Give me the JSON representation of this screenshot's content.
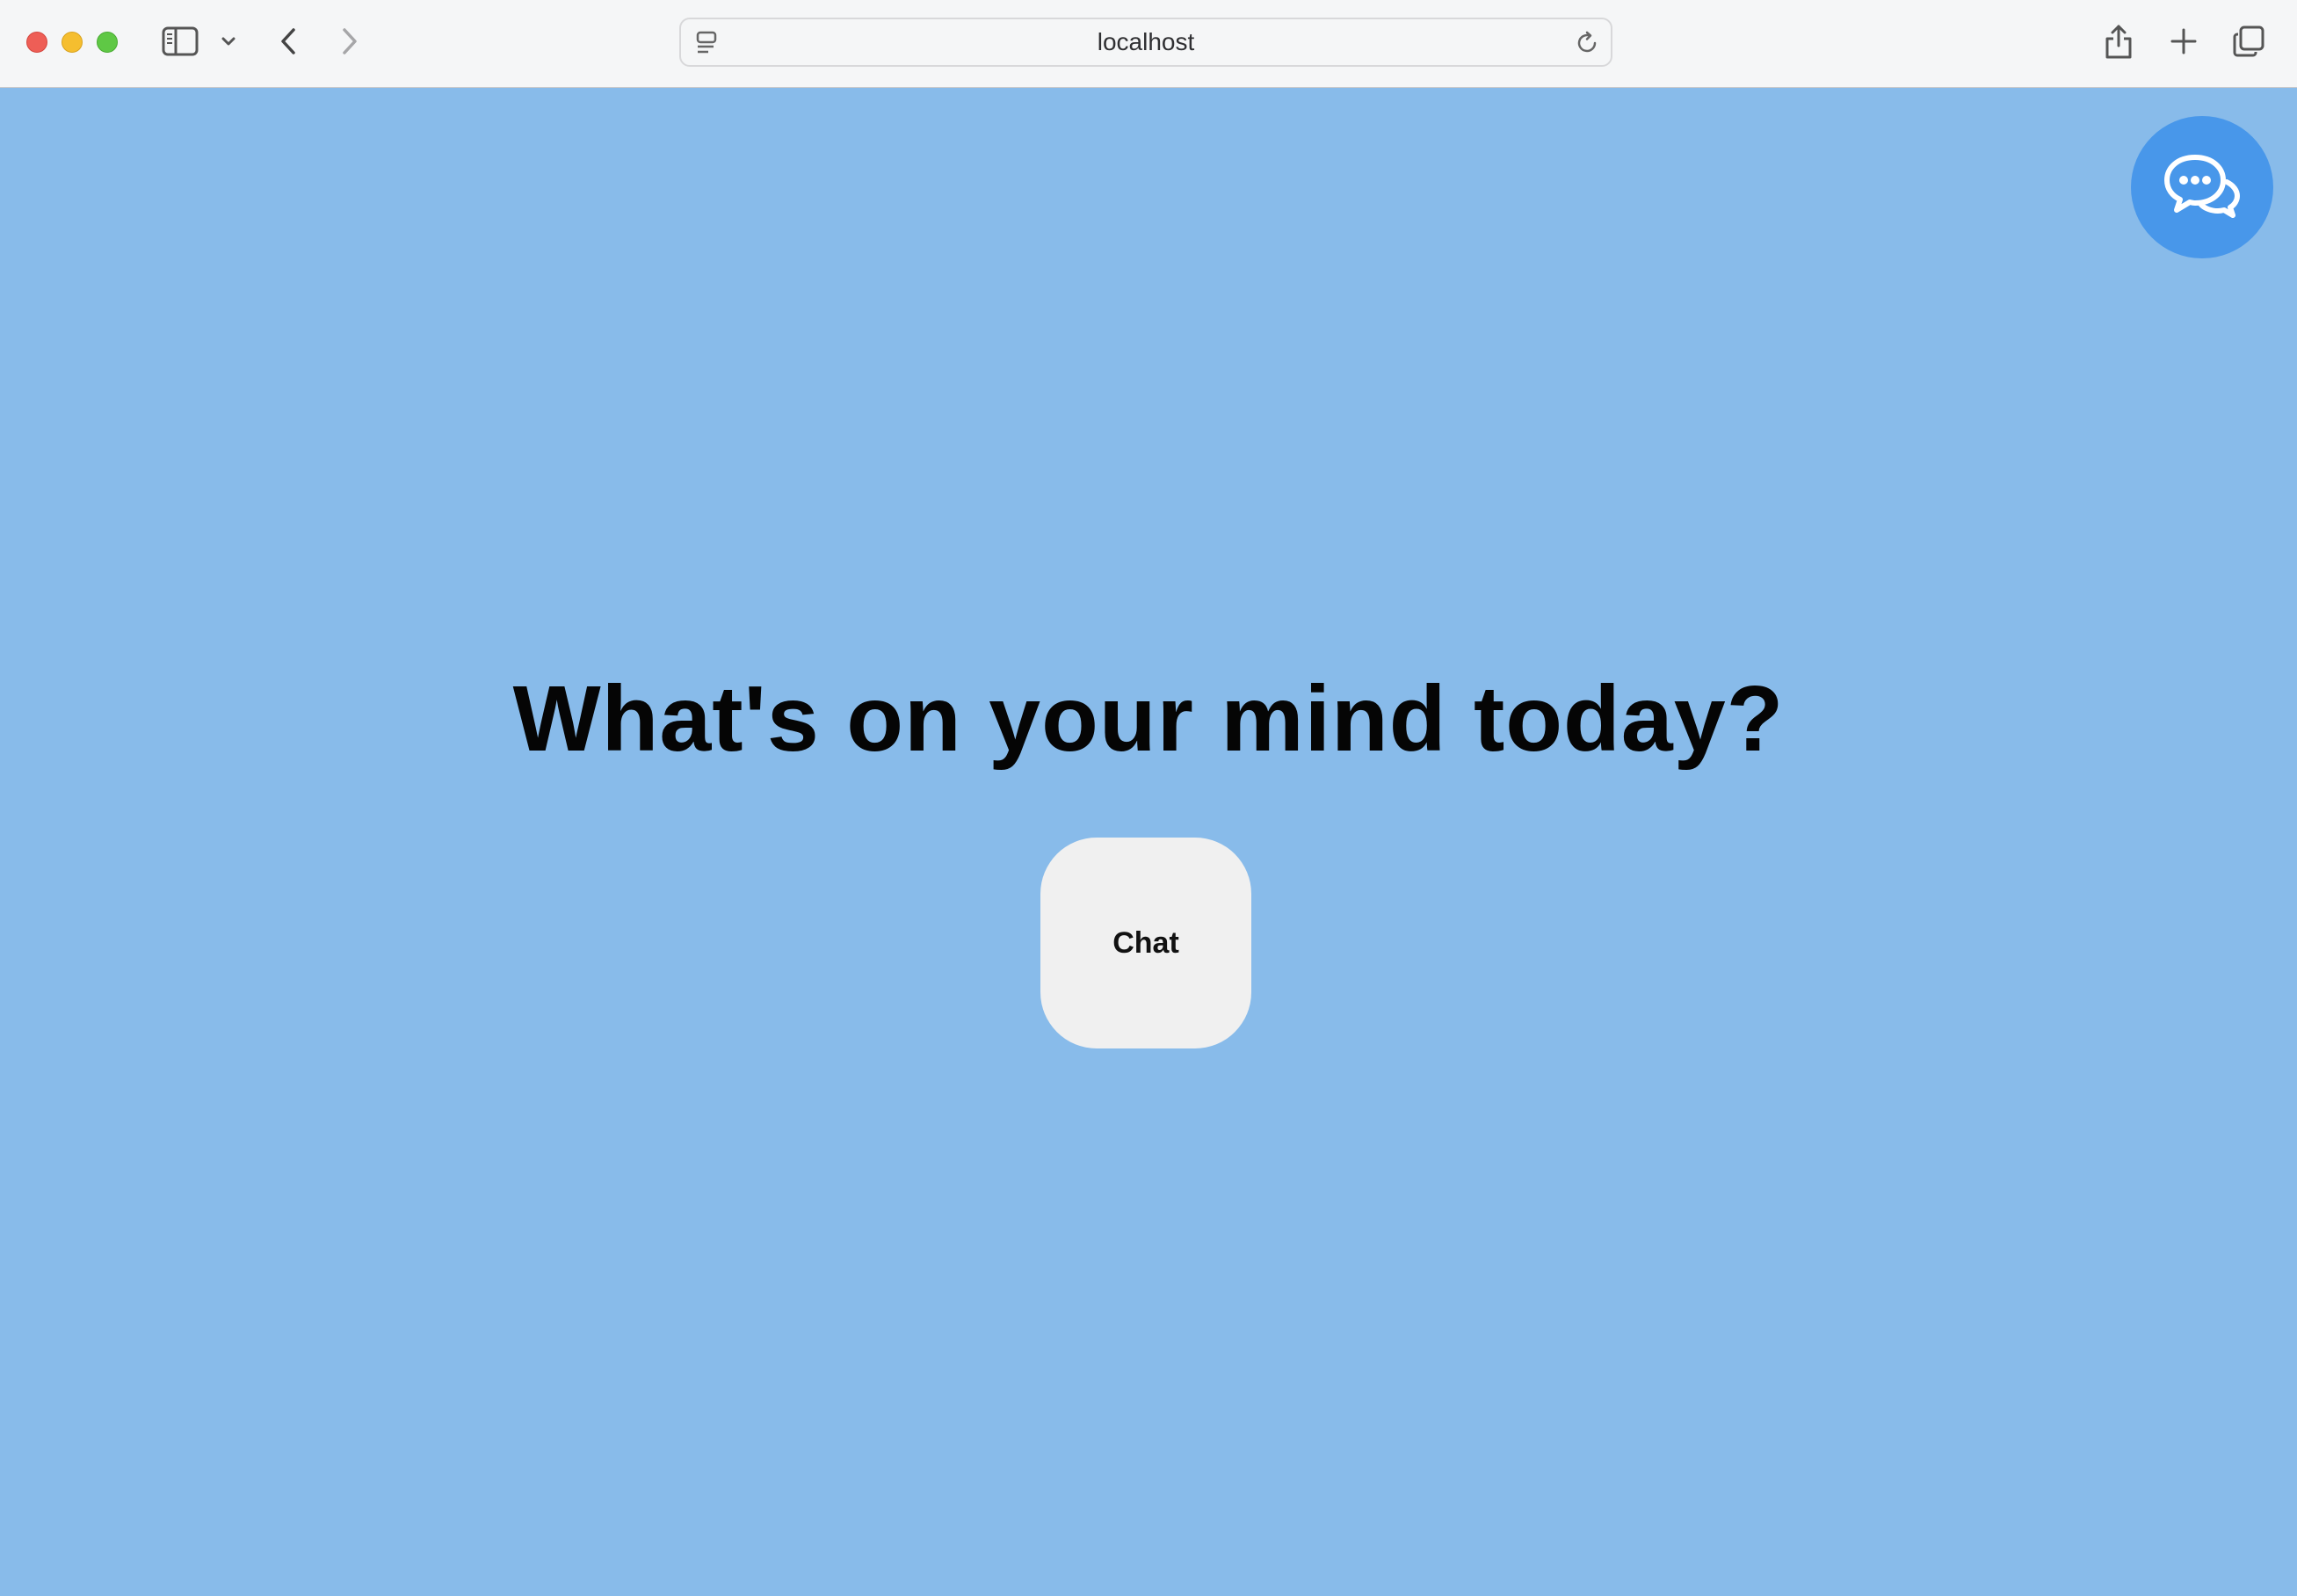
{
  "browser": {
    "address": "localhost"
  },
  "page": {
    "headline": "What's on your mind today?",
    "chat_button_label": "Chat",
    "background_color": "#88bbea",
    "fab_color": "#4897ea",
    "fab_icon": "chat-bubbles-icon"
  }
}
